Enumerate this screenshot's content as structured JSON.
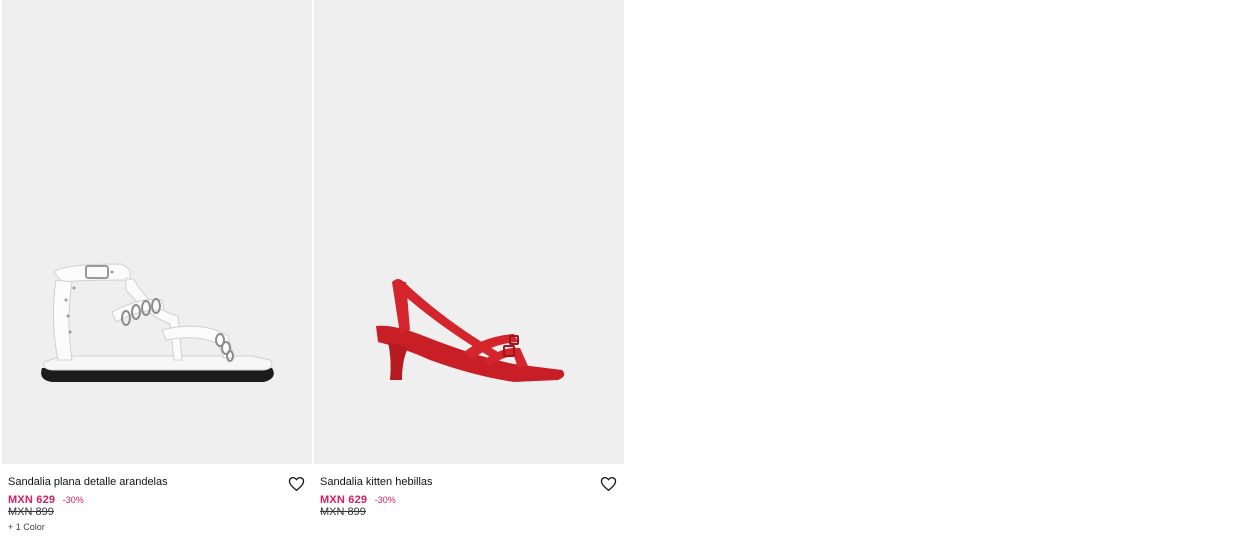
{
  "products": [
    {
      "name": "Sandalia plana detalle arandelas",
      "price": "MXN 629",
      "discount": "-30%",
      "old_price": "MXN 899",
      "colors": "+ 1 Color",
      "image_color": "#f4f4f2"
    },
    {
      "name": "Sandalia kitten hebillas",
      "price": "MXN 629",
      "discount": "-30%",
      "old_price": "MXN 899",
      "colors": "",
      "image_color": "#d4242c"
    }
  ],
  "icons": {
    "wishlist": "heart-outline-icon"
  },
  "colors": {
    "sale": "#d6205e",
    "image_bg": "#efefef"
  }
}
